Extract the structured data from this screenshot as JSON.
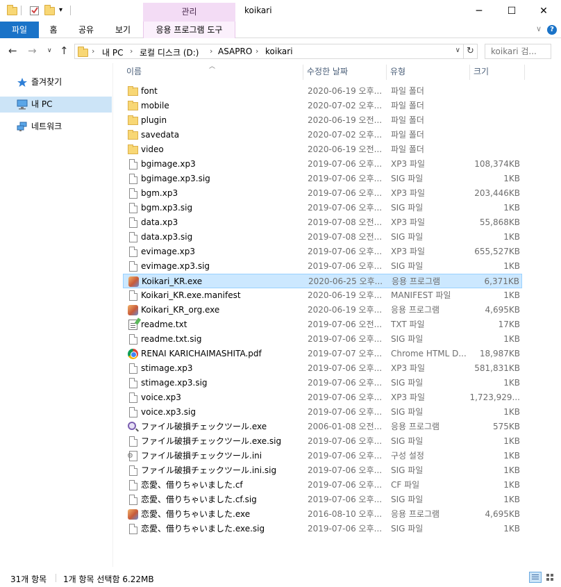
{
  "window": {
    "title": "koikari",
    "contextual_tab_group": "관리",
    "minimize_glyph": "─",
    "maximize_glyph": "☐",
    "close_glyph": "✕"
  },
  "ribbon": {
    "tabs": [
      {
        "label": "파일"
      },
      {
        "label": "홈"
      },
      {
        "label": "공유"
      },
      {
        "label": "보기"
      },
      {
        "label": "응용 프로그램 도구"
      }
    ],
    "help_glyph": "?",
    "collapse_glyph": "∨"
  },
  "address": {
    "breadcrumbs": [
      "내 PC",
      "로컬 디스크 (D:)",
      "ASAPRO",
      "koikari"
    ],
    "separator": "›",
    "search_placeholder": "koikari 검..."
  },
  "nav": {
    "items": [
      {
        "label": "즐겨찾기",
        "icon": "star-icon"
      },
      {
        "label": "내 PC",
        "icon": "computer-icon"
      },
      {
        "label": "네트워크",
        "icon": "network-icon"
      }
    ]
  },
  "columns": {
    "name": "이름",
    "date": "수정한 날짜",
    "type": "유형",
    "size": "크기"
  },
  "files": [
    {
      "name": "font",
      "date": "2020-06-19 오후...",
      "type": "파일 폴더",
      "size": "",
      "icon": "folder"
    },
    {
      "name": "mobile",
      "date": "2020-07-02 오후...",
      "type": "파일 폴더",
      "size": "",
      "icon": "folder"
    },
    {
      "name": "plugin",
      "date": "2020-06-19 오전...",
      "type": "파일 폴더",
      "size": "",
      "icon": "folder"
    },
    {
      "name": "savedata",
      "date": "2020-07-02 오후...",
      "type": "파일 폴더",
      "size": "",
      "icon": "folder"
    },
    {
      "name": "video",
      "date": "2020-06-19 오전...",
      "type": "파일 폴더",
      "size": "",
      "icon": "folder"
    },
    {
      "name": "bgimage.xp3",
      "date": "2019-07-06 오후...",
      "type": "XP3 파일",
      "size": "108,374KB",
      "icon": "file"
    },
    {
      "name": "bgimage.xp3.sig",
      "date": "2019-07-06 오후...",
      "type": "SIG 파일",
      "size": "1KB",
      "icon": "file"
    },
    {
      "name": "bgm.xp3",
      "date": "2019-07-06 오후...",
      "type": "XP3 파일",
      "size": "203,446KB",
      "icon": "file"
    },
    {
      "name": "bgm.xp3.sig",
      "date": "2019-07-06 오후...",
      "type": "SIG 파일",
      "size": "1KB",
      "icon": "file"
    },
    {
      "name": "data.xp3",
      "date": "2019-07-08 오전...",
      "type": "XP3 파일",
      "size": "55,868KB",
      "icon": "file"
    },
    {
      "name": "data.xp3.sig",
      "date": "2019-07-08 오전...",
      "type": "SIG 파일",
      "size": "1KB",
      "icon": "file"
    },
    {
      "name": "evimage.xp3",
      "date": "2019-07-06 오후...",
      "type": "XP3 파일",
      "size": "655,527KB",
      "icon": "file"
    },
    {
      "name": "evimage.xp3.sig",
      "date": "2019-07-06 오후...",
      "type": "SIG 파일",
      "size": "1KB",
      "icon": "file"
    },
    {
      "name": "Koikari_KR.exe",
      "date": "2020-06-25 오후...",
      "type": "응용 프로그램",
      "size": "6,371KB",
      "icon": "exe",
      "selected": true
    },
    {
      "name": "Koikari_KR.exe.manifest",
      "date": "2020-06-19 오후...",
      "type": "MANIFEST 파일",
      "size": "1KB",
      "icon": "file"
    },
    {
      "name": "Koikari_KR_org.exe",
      "date": "2020-06-19 오후...",
      "type": "응용 프로그램",
      "size": "4,695KB",
      "icon": "exe"
    },
    {
      "name": "readme.txt",
      "date": "2019-07-06 오전...",
      "type": "TXT 파일",
      "size": "17KB",
      "icon": "txt"
    },
    {
      "name": "readme.txt.sig",
      "date": "2019-07-06 오후...",
      "type": "SIG 파일",
      "size": "1KB",
      "icon": "file"
    },
    {
      "name": "RENAI KARICHAIMASHITA.pdf",
      "date": "2019-07-07 오후...",
      "type": "Chrome HTML D...",
      "size": "18,987KB",
      "icon": "chrome"
    },
    {
      "name": "stimage.xp3",
      "date": "2019-07-06 오후...",
      "type": "XP3 파일",
      "size": "581,831KB",
      "icon": "file"
    },
    {
      "name": "stimage.xp3.sig",
      "date": "2019-07-06 오후...",
      "type": "SIG 파일",
      "size": "1KB",
      "icon": "file"
    },
    {
      "name": "voice.xp3",
      "date": "2019-07-06 오후...",
      "type": "XP3 파일",
      "size": "1,723,929...",
      "icon": "file"
    },
    {
      "name": "voice.xp3.sig",
      "date": "2019-07-06 오후...",
      "type": "SIG 파일",
      "size": "1KB",
      "icon": "file"
    },
    {
      "name": "ファイル破損チェックツール.exe",
      "date": "2006-01-08 오전...",
      "type": "응용 프로그램",
      "size": "575KB",
      "icon": "search"
    },
    {
      "name": "ファイル破損チェックツール.exe.sig",
      "date": "2019-07-06 오후...",
      "type": "SIG 파일",
      "size": "1KB",
      "icon": "file"
    },
    {
      "name": "ファイル破損チェックツール.ini",
      "date": "2019-07-06 오후...",
      "type": "구성 설정",
      "size": "1KB",
      "icon": "ini"
    },
    {
      "name": "ファイル破損チェックツール.ini.sig",
      "date": "2019-07-06 오후...",
      "type": "SIG 파일",
      "size": "1KB",
      "icon": "file"
    },
    {
      "name": "恋愛、借りちゃいました.cf",
      "date": "2019-07-06 오후...",
      "type": "CF 파일",
      "size": "1KB",
      "icon": "file"
    },
    {
      "name": "恋愛、借りちゃいました.cf.sig",
      "date": "2019-07-06 오후...",
      "type": "SIG 파일",
      "size": "1KB",
      "icon": "file"
    },
    {
      "name": "恋愛、借りちゃいました.exe",
      "date": "2016-08-10 오후...",
      "type": "응용 프로그램",
      "size": "4,695KB",
      "icon": "exe"
    },
    {
      "name": "恋愛、借りちゃいました.exe.sig",
      "date": "2019-07-06 오후...",
      "type": "SIG 파일",
      "size": "1KB",
      "icon": "file"
    }
  ],
  "status": {
    "item_count": "31개 항목",
    "selection": "1개 항목 선택함 6.22MB"
  },
  "colors": {
    "accent": "#1a73c8",
    "selection": "#cce8ff",
    "context_tab": "#f3dcf5"
  }
}
